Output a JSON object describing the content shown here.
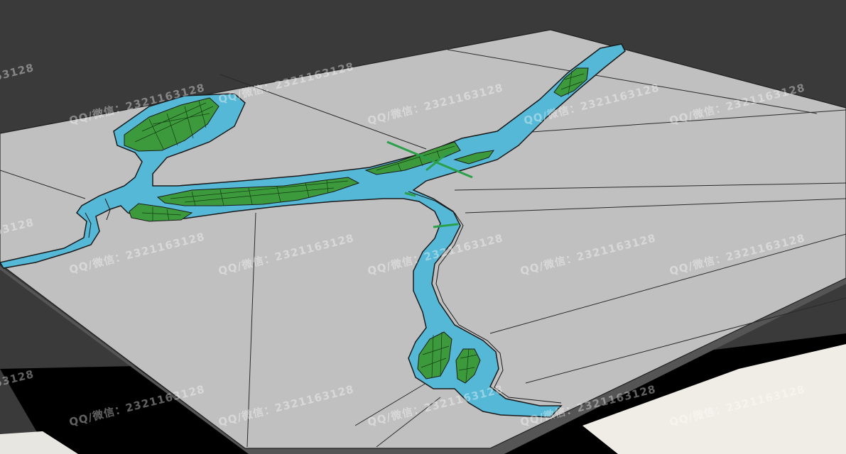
{
  "viewport": {
    "background_color": "#3a3a3a",
    "terrain_color": "#c0c0c0",
    "river_color": "#55b8d6",
    "island_color": "#3c9a3c",
    "edge_color": "#1a1a1a"
  },
  "watermark": {
    "text": "QQ/微信：2321163128",
    "partial_text": "63128"
  }
}
